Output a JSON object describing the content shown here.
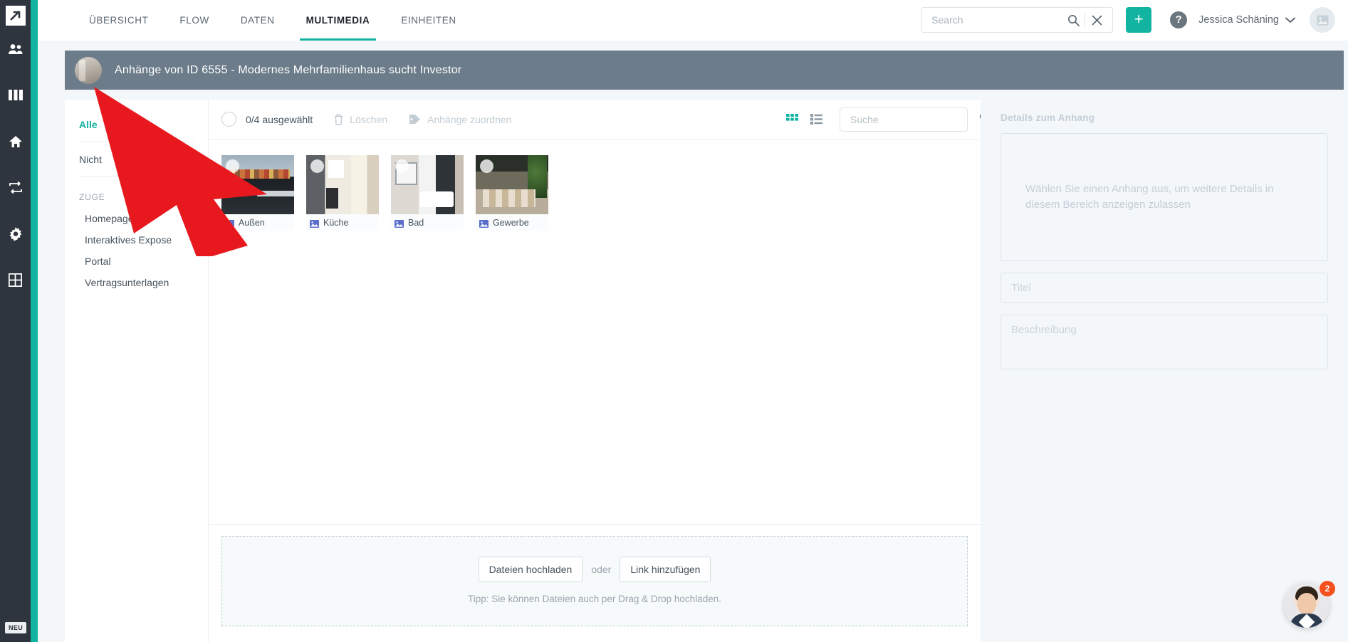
{
  "rail": {
    "logo_name": "arrow-logo",
    "items": [
      {
        "name": "contacts-icon",
        "label": "Kontakte"
      },
      {
        "name": "columns-icon",
        "label": "Pipeline"
      },
      {
        "name": "home-icon",
        "label": "Objekte"
      },
      {
        "name": "sync-icon",
        "label": "Abgleich"
      },
      {
        "name": "gear-icon",
        "label": "Einstellungen"
      },
      {
        "name": "grid-icon",
        "label": "Module"
      }
    ],
    "new_badge": "NEU"
  },
  "header": {
    "tabs": [
      {
        "label": "ÜBERSICHT",
        "active": false
      },
      {
        "label": "FLOW",
        "active": false
      },
      {
        "label": "DATEN",
        "active": false
      },
      {
        "label": "MULTIMEDIA",
        "active": true
      },
      {
        "label": "EINHEITEN",
        "active": false
      }
    ],
    "search": {
      "value": "",
      "placeholder": "Search"
    },
    "add_label": "+",
    "help_label": "?",
    "user_name": "Jessica Schäning"
  },
  "titlebar": {
    "title": "Anhänge von ID 6555 - Modernes Mehrfamilienhaus sucht Investor"
  },
  "filters": {
    "primary": [
      {
        "label": "Alle",
        "active": true
      },
      {
        "label": "Nicht",
        "active": false
      }
    ],
    "group_title": "ZUGE",
    "items": [
      {
        "label": "Homepage"
      },
      {
        "label": "Interaktives Expose"
      },
      {
        "label": "Portal"
      },
      {
        "label": "Vertragsunterlagen"
      }
    ]
  },
  "toolbar": {
    "selected_count": "0/4 ausgewählt",
    "delete_label": "Löschen",
    "assign_label": "Anhänge zuordnen",
    "grid_view_name": "grid-view-icon",
    "list_view_name": "list-view-icon",
    "search": {
      "value": "",
      "placeholder": "Suche"
    }
  },
  "attachments": [
    {
      "title": "Außen",
      "art": "art-aussen",
      "selected": false
    },
    {
      "title": "Küche",
      "art": "art-kueche",
      "selected": false
    },
    {
      "title": "Bad",
      "art": "art-bad",
      "selected": false
    },
    {
      "title": "Gewerbe",
      "art": "art-gewerbe",
      "selected": false
    }
  ],
  "upload": {
    "file_button": "Dateien hochladen",
    "or_label": "oder",
    "link_button": "Link hinzufügen",
    "tip": "Tipp: Sie können Dateien auch per Drag & Drop hochladen."
  },
  "details": {
    "heading": "Details zum Anhang",
    "empty_text": "Wählen Sie einen Anhang aus, um weitere Details in diesem Bereich anzeigen zulassen",
    "title_field": {
      "value": "",
      "placeholder": "Titel"
    },
    "description_field": {
      "value": "",
      "placeholder": "Beschreibung"
    }
  },
  "chat": {
    "badge_count": "2"
  },
  "colors": {
    "accent": "#12b3a0",
    "rail_bg": "#2f353e",
    "titlebar_bg": "#6c7c8a",
    "annotation_red": "#e8191e",
    "badge_orange": "#f4511e"
  }
}
